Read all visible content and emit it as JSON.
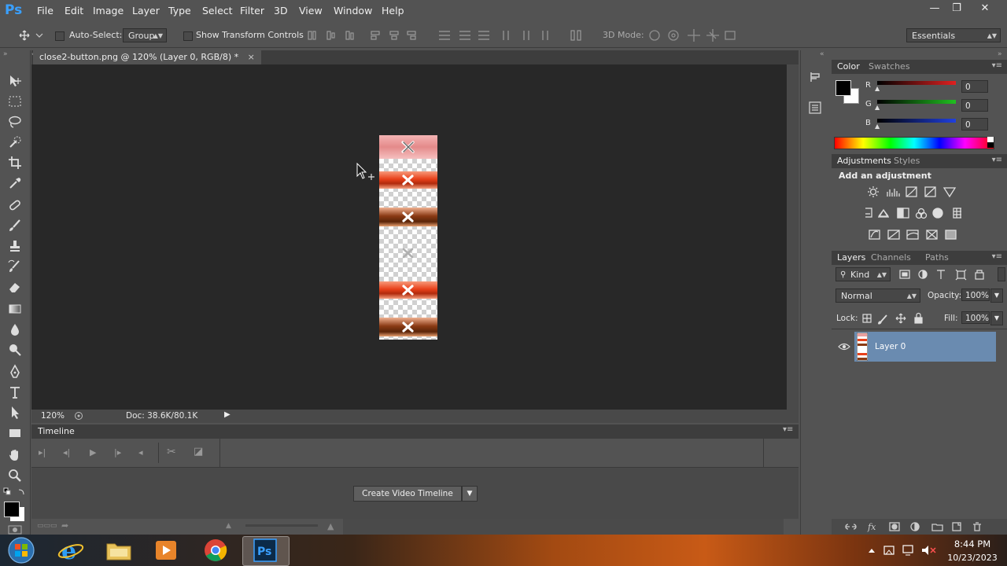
{
  "app": {
    "logo": "Ps"
  },
  "menu": [
    "File",
    "Edit",
    "Image",
    "Layer",
    "Type",
    "Select",
    "Filter",
    "3D",
    "View",
    "Window",
    "Help"
  ],
  "window_controls": {
    "minimize": "—",
    "restore": "❐",
    "close": "✕"
  },
  "options": {
    "auto_select_label": "Auto-Select:",
    "auto_select_value": "Group",
    "transform_label": "Show Transform Controls",
    "mode_label": "3D Mode:",
    "workspace": "Essentials"
  },
  "document": {
    "tab_title": "close2-button.png @ 120% (Layer 0, RGB/8) *",
    "tab_close": "×",
    "zoom": "120%",
    "doc_info": "Doc: 38.6K/80.1K"
  },
  "timeline": {
    "title": "Timeline",
    "create_button": "Create Video Timeline"
  },
  "color_panel": {
    "tabs": [
      "Color",
      "Swatches"
    ],
    "channels": [
      {
        "label": "R",
        "value": "0",
        "color": "#e02020"
      },
      {
        "label": "G",
        "value": "0",
        "color": "#20c020"
      },
      {
        "label": "B",
        "value": "0",
        "color": "#2040e0"
      }
    ]
  },
  "adjustments_panel": {
    "tabs": [
      "Adjustments",
      "Styles"
    ],
    "heading": "Add an adjustment"
  },
  "layers_panel": {
    "tabs": [
      "Layers",
      "Channels",
      "Paths"
    ],
    "filter": "Kind",
    "blend_mode": "Normal",
    "opacity_label": "Opacity:",
    "opacity_value": "100%",
    "lock_label": "Lock:",
    "fill_label": "Fill:",
    "fill_value": "100%",
    "layers": [
      {
        "name": "Layer 0",
        "visible": true,
        "selected": true
      }
    ],
    "footer_icons": [
      "link-icon",
      "fx-icon",
      "mask-icon",
      "adjustment-layer-icon",
      "folder-icon",
      "new-layer-icon",
      "trash-icon"
    ]
  },
  "taskbar": {
    "apps": [
      "windows-start-icon",
      "internet-explorer-icon",
      "file-explorer-icon",
      "media-player-icon",
      "chrome-icon",
      "photoshop-icon"
    ],
    "time": "8:44 PM",
    "date": "10/23/2023"
  }
}
